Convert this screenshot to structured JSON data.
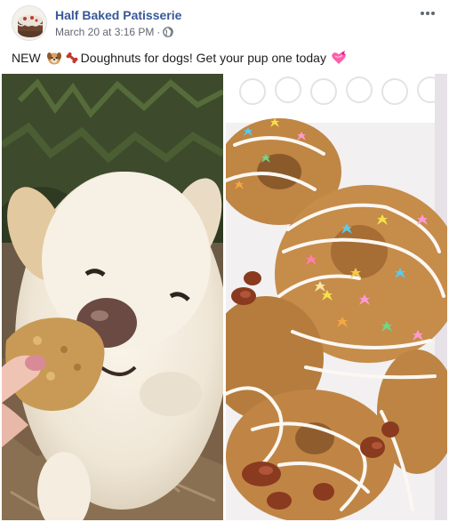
{
  "post": {
    "page_name": "Half Baked Patisserie",
    "timestamp": "March 20 at 3:16 PM",
    "separator": "·",
    "privacy_icon": "globe-icon",
    "options_icon": "more-options-icon",
    "message": {
      "prefix": "NEW",
      "emoji_1": "dog-face-emoji",
      "emoji_2": "bone-emoji",
      "text": "Doughnuts for dogs! Get your pup one today",
      "emoji_3": "heart-with-ribbon-emoji"
    },
    "photos": [
      {
        "name": "photo-dog-eating-treat",
        "subject": "white-dog-eating-biscuit"
      },
      {
        "name": "photo-dog-doughnuts",
        "subject": "frosted-dog-doughnuts-with-sprinkles"
      }
    ]
  },
  "colors": {
    "link": "#385898",
    "meta": "#616770",
    "text": "#1c1e21"
  }
}
